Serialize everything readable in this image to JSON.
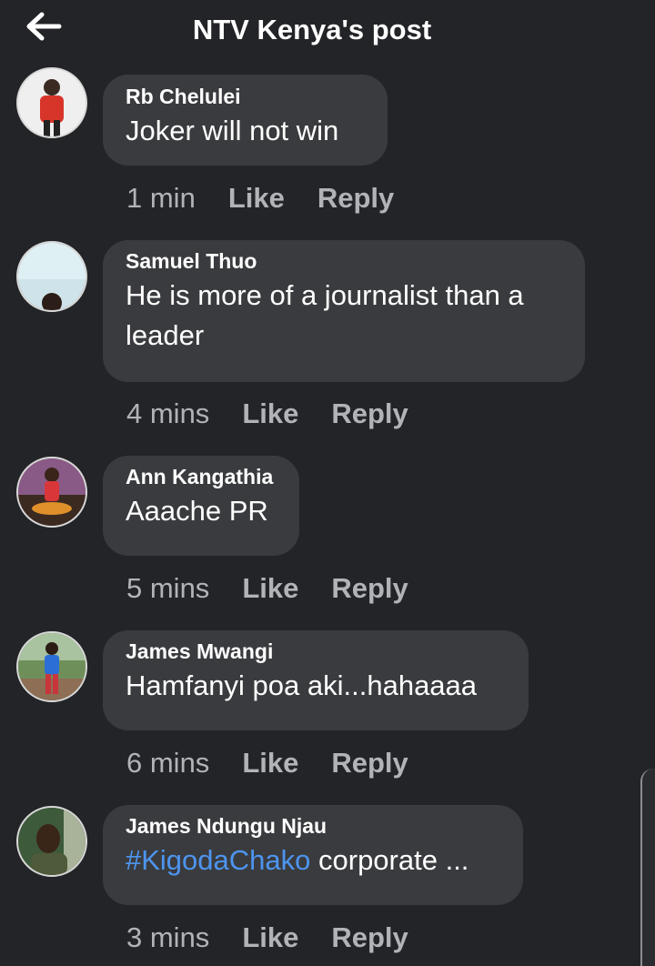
{
  "header": {
    "title": "NTV Kenya's post",
    "back_icon": "arrow-left-icon"
  },
  "comments": [
    {
      "author": "Rb Chelulei",
      "text": "Joker will not win",
      "time": "1 min",
      "like": "Like",
      "reply": "Reply"
    },
    {
      "author": "Samuel Thuo",
      "text": "He is more of a journalist than a leader",
      "time": "4 mins",
      "like": "Like",
      "reply": "Reply"
    },
    {
      "author": "Ann Kangathia",
      "text": "Aaache PR",
      "time": "5 mins",
      "like": "Like",
      "reply": "Reply"
    },
    {
      "author": "James Mwangi",
      "text": "Hamfanyi poa aki...hahaaaa",
      "time": "6 mins",
      "like": "Like",
      "reply": "Reply"
    },
    {
      "author": "James Ndungu Njau",
      "hashtag": "#KigodaChako",
      "text": " corporate ...",
      "time": "3 mins",
      "like": "Like",
      "reply": "Reply"
    }
  ]
}
